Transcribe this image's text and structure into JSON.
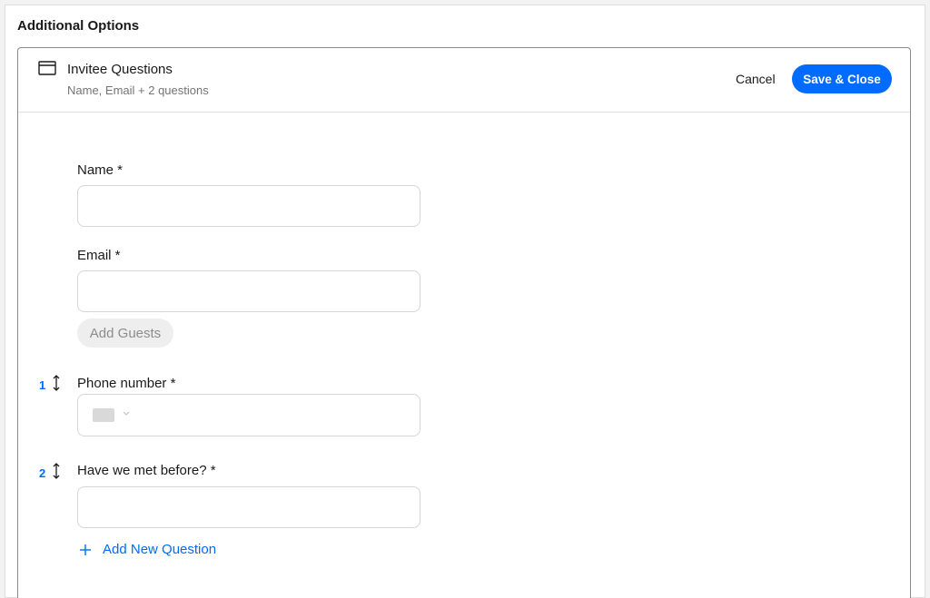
{
  "section": {
    "title": "Additional Options"
  },
  "header": {
    "icon": "card-icon",
    "title": "Invitee Questions",
    "subtitle": "Name, Email + 2 questions",
    "cancel_label": "Cancel",
    "save_label": "Save & Close"
  },
  "fields": {
    "name": {
      "label": "Name *",
      "value": ""
    },
    "email": {
      "label": "Email *",
      "value": ""
    },
    "add_guests_label": "Add Guests"
  },
  "questions": [
    {
      "number": "1",
      "label": "Phone number *",
      "type": "phone",
      "icon": "flag-placeholder"
    },
    {
      "number": "2",
      "label": "Have we met before? *",
      "type": "text",
      "value": ""
    }
  ],
  "add_question_label": "Add New Question",
  "colors": {
    "accent": "#006bff",
    "border": "#d6d6d6",
    "muted": "#737373"
  }
}
